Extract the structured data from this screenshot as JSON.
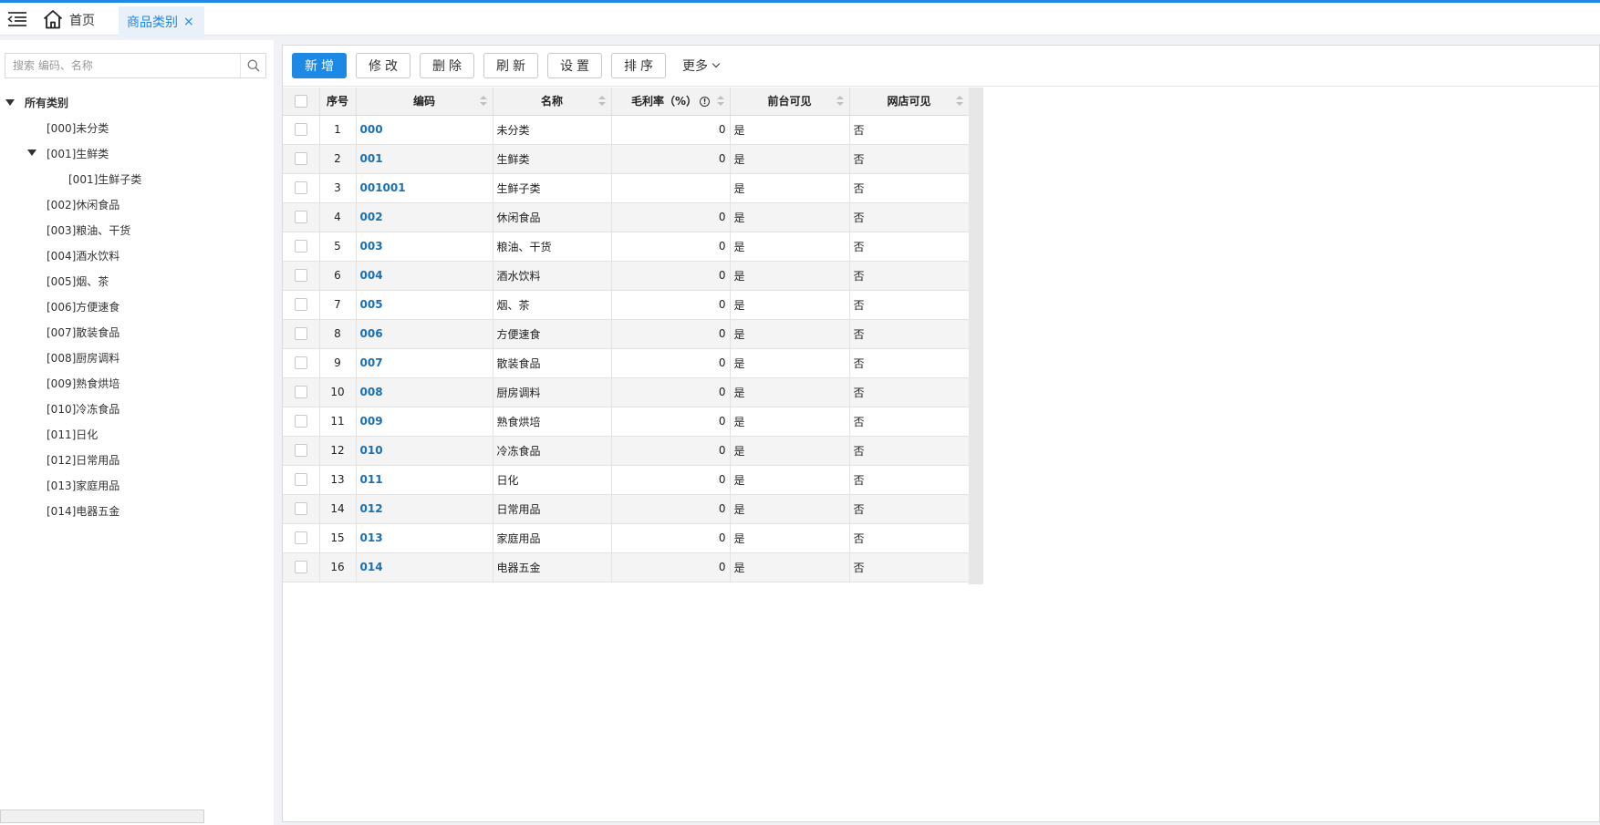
{
  "header": {
    "home_label": "首页",
    "active_tab_label": "商品类别",
    "close_glyph": "×"
  },
  "colors": {
    "accent": "#1e88e5",
    "link": "#1a6fb5"
  },
  "sidebar": {
    "search_placeholder": "搜索 编码、名称",
    "tree_root": "所有类别",
    "nodes": [
      "[000]未分类",
      "[001]生鲜类",
      "[001]生鲜子类",
      "[002]休闲食品",
      "[003]粮油、干货",
      "[004]酒水饮料",
      "[005]烟、茶",
      "[006]方便速食",
      "[007]散装食品",
      "[008]厨房调料",
      "[009]熟食烘培",
      "[010]冷冻食品",
      "[011]日化",
      "[012]日常用品",
      "[013]家庭用品",
      "[014]电器五金"
    ]
  },
  "toolbar": {
    "add": "新增",
    "edit": "修改",
    "delete": "删除",
    "refresh": "刷新",
    "settings": "设置",
    "sort": "排序",
    "more": "更多"
  },
  "table": {
    "columns": {
      "index": "序号",
      "code": "编码",
      "name": "名称",
      "margin": "毛利率（%）",
      "front_visible": "前台可见",
      "online_visible": "网店可见"
    },
    "rows": [
      {
        "index": "1",
        "code": "000",
        "name": "未分类",
        "margin": "0",
        "front": "是",
        "online": "否"
      },
      {
        "index": "2",
        "code": "001",
        "name": "生鲜类",
        "margin": "0",
        "front": "是",
        "online": "否"
      },
      {
        "index": "3",
        "code": "001001",
        "name": "生鲜子类",
        "margin": "",
        "front": "是",
        "online": "否"
      },
      {
        "index": "4",
        "code": "002",
        "name": "休闲食品",
        "margin": "0",
        "front": "是",
        "online": "否"
      },
      {
        "index": "5",
        "code": "003",
        "name": "粮油、干货",
        "margin": "0",
        "front": "是",
        "online": "否"
      },
      {
        "index": "6",
        "code": "004",
        "name": "酒水饮料",
        "margin": "0",
        "front": "是",
        "online": "否"
      },
      {
        "index": "7",
        "code": "005",
        "name": "烟、茶",
        "margin": "0",
        "front": "是",
        "online": "否"
      },
      {
        "index": "8",
        "code": "006",
        "name": "方便速食",
        "margin": "0",
        "front": "是",
        "online": "否"
      },
      {
        "index": "9",
        "code": "007",
        "name": "散装食品",
        "margin": "0",
        "front": "是",
        "online": "否"
      },
      {
        "index": "10",
        "code": "008",
        "name": "厨房调料",
        "margin": "0",
        "front": "是",
        "online": "否"
      },
      {
        "index": "11",
        "code": "009",
        "name": "熟食烘培",
        "margin": "0",
        "front": "是",
        "online": "否"
      },
      {
        "index": "12",
        "code": "010",
        "name": "冷冻食品",
        "margin": "0",
        "front": "是",
        "online": "否"
      },
      {
        "index": "13",
        "code": "011",
        "name": "日化",
        "margin": "0",
        "front": "是",
        "online": "否"
      },
      {
        "index": "14",
        "code": "012",
        "name": "日常用品",
        "margin": "0",
        "front": "是",
        "online": "否"
      },
      {
        "index": "15",
        "code": "013",
        "name": "家庭用品",
        "margin": "0",
        "front": "是",
        "online": "否"
      },
      {
        "index": "16",
        "code": "014",
        "name": "电器五金",
        "margin": "0",
        "front": "是",
        "online": "否"
      }
    ]
  }
}
